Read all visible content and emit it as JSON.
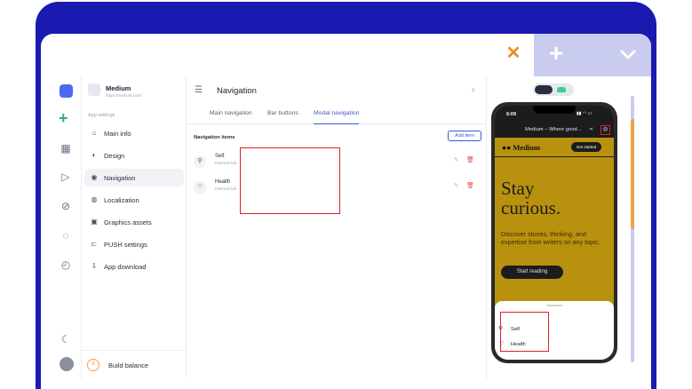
{
  "browser": {
    "close_icon": "close-icon",
    "new_tab_icon": "plus-icon",
    "menu_icon": "chevron-down-icon",
    "colors": {
      "frame": "#1a1ab0",
      "accent": "#f08a1c"
    }
  },
  "app": {
    "name": "Medium",
    "url": "https://medium.com/"
  },
  "sidebar": {
    "section_label": "App settings",
    "items": [
      {
        "label": "Main info",
        "icon": "home-icon"
      },
      {
        "label": "Design",
        "icon": "palette-icon"
      },
      {
        "label": "Navigation",
        "icon": "compass-icon",
        "active": true
      },
      {
        "label": "Localization",
        "icon": "globe-icon"
      },
      {
        "label": "Graphics assets",
        "icon": "image-icon"
      },
      {
        "label": "PUSH settings",
        "icon": "push-icon"
      },
      {
        "label": "App download",
        "icon": "download-icon"
      }
    ],
    "build_label": "Build balance"
  },
  "main": {
    "title": "Navigation",
    "tabs": [
      {
        "label": "Main navigation"
      },
      {
        "label": "Bar buttons"
      },
      {
        "label": "Modal navigation",
        "active": true
      }
    ],
    "section_label": "Navigation items",
    "add_label": "Add item",
    "items": [
      {
        "title": "Self",
        "subtitle": "Internal link",
        "icon": "user-icon"
      },
      {
        "title": "Health",
        "subtitle": "Internal link",
        "icon": "heart-icon"
      }
    ]
  },
  "preview": {
    "time": "6:09",
    "nav_title": "Medium – Where good…",
    "logo": "Medium",
    "get_started": "Get started",
    "hero_line1": "Stay",
    "hero_line2": "curious.",
    "hero_sub": "Discover stories, thinking, and expertise from writers on any topic.",
    "cta": "Start reading",
    "sheet_items": [
      {
        "label": "Self",
        "icon": "user-icon"
      },
      {
        "label": "Health",
        "icon": "heart-icon"
      }
    ]
  }
}
